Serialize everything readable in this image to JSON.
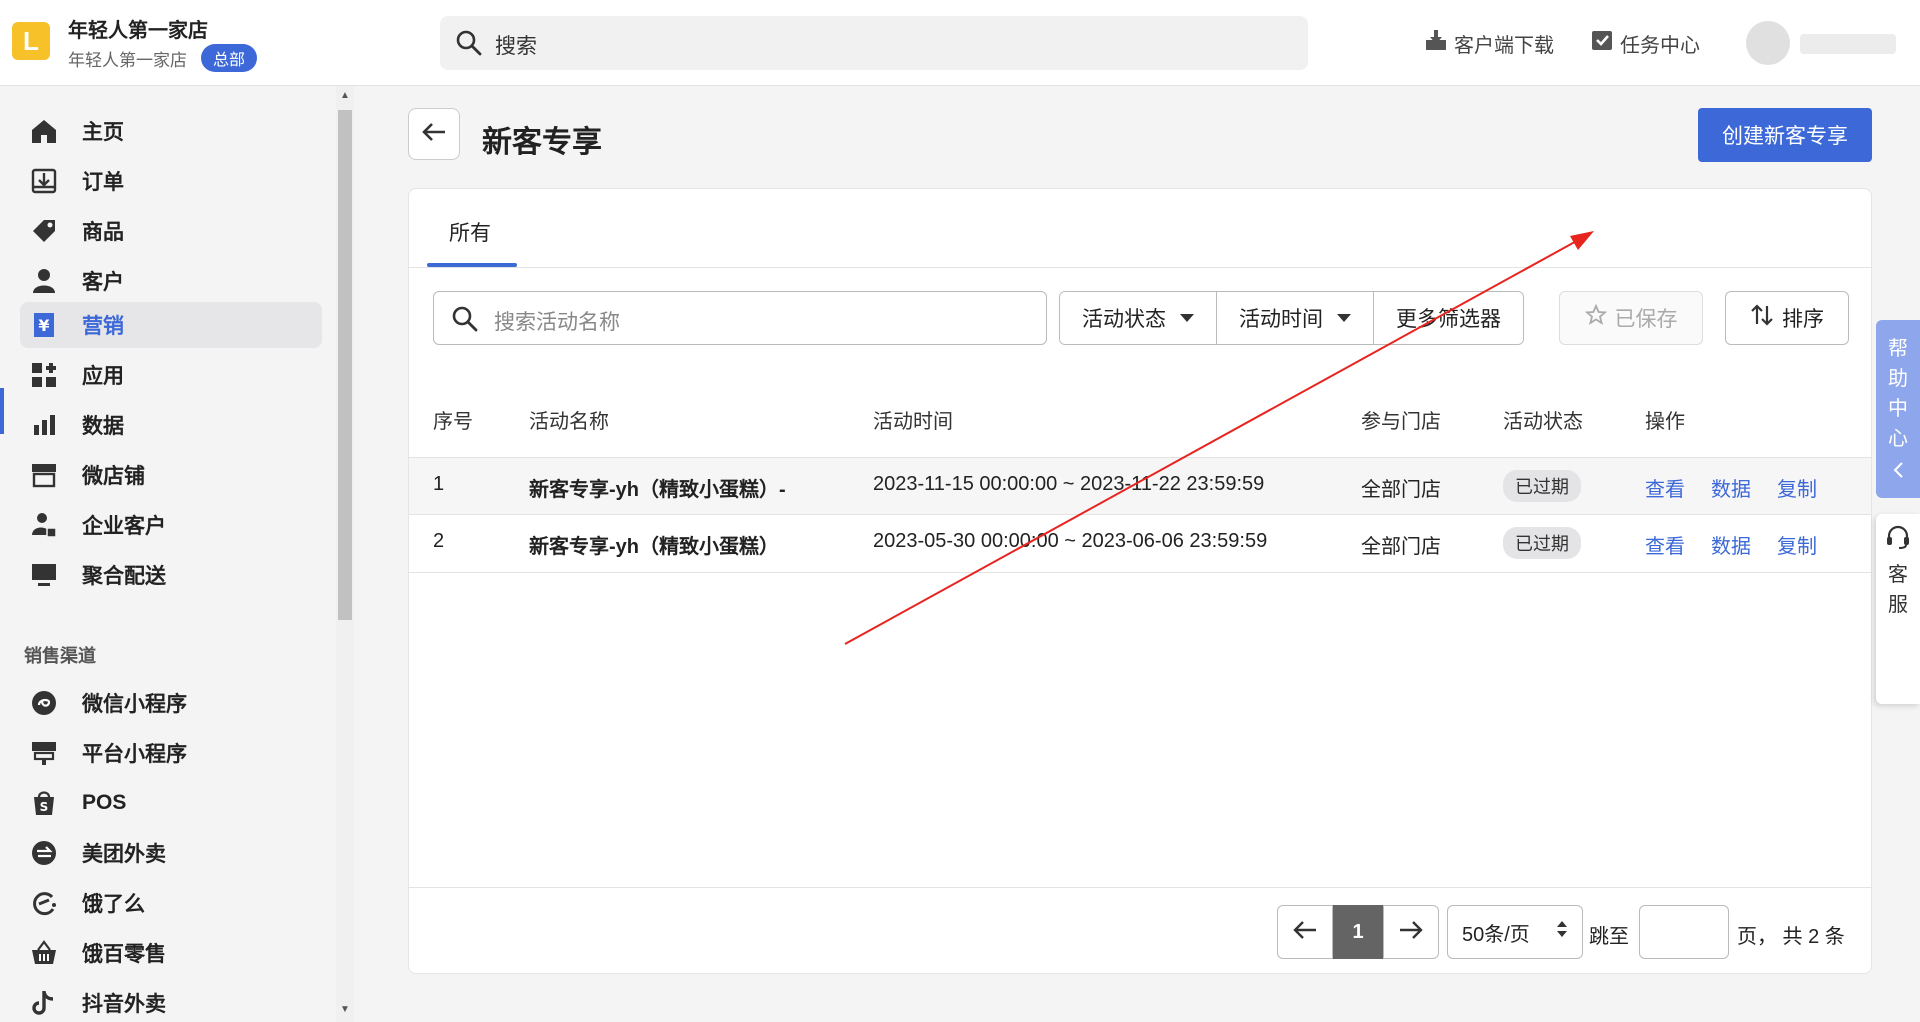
{
  "header": {
    "logo_letter": "L",
    "store_name": "年轻人第一家店",
    "store_sub": "年轻人第一家店",
    "hq_badge": "总部",
    "search_placeholder": "搜索",
    "download_label": "客户端下载",
    "tasks_label": "任务中心"
  },
  "sidebar": {
    "items": [
      {
        "label": "主页",
        "icon": "home-icon"
      },
      {
        "label": "订单",
        "icon": "order-icon"
      },
      {
        "label": "商品",
        "icon": "tag-icon"
      },
      {
        "label": "客户",
        "icon": "person-icon"
      },
      {
        "label": "营销",
        "icon": "yen-ticket-icon"
      },
      {
        "label": "应用",
        "icon": "apps-icon"
      },
      {
        "label": "数据",
        "icon": "bar-chart-icon"
      },
      {
        "label": "微店铺",
        "icon": "store-icon"
      },
      {
        "label": "企业客户",
        "icon": "enterprise-icon"
      },
      {
        "label": "聚合配送",
        "icon": "monitor-icon"
      }
    ],
    "section_title": "销售渠道",
    "channels": [
      {
        "label": "微信小程序",
        "icon": "mini-program-icon"
      },
      {
        "label": "平台小程序",
        "icon": "platform-icon"
      },
      {
        "label": "POS",
        "icon": "shopping-bag-icon"
      },
      {
        "label": "美团外卖",
        "icon": "meituan-icon"
      },
      {
        "label": "饿了么",
        "icon": "eleme-icon"
      },
      {
        "label": "饿百零售",
        "icon": "basket-icon"
      },
      {
        "label": "抖音外卖",
        "icon": "douyin-icon"
      }
    ]
  },
  "page": {
    "title": "新客专享",
    "create_button": "创建新客专享",
    "tab_all": "所有"
  },
  "filters": {
    "search_placeholder": "搜索活动名称",
    "status": "活动状态",
    "time": "活动时间",
    "more": "更多筛选器",
    "saved": "已保存",
    "sort": "排序"
  },
  "table": {
    "columns": [
      "序号",
      "活动名称",
      "活动时间",
      "参与门店",
      "活动状态",
      "操作"
    ],
    "rows": [
      {
        "index": "1",
        "name": "新客专享-yh（精致小蛋糕）-",
        "time": "2023-11-15 00:00:00 ~ 2023-11-22 23:59:59",
        "stores": "全部门店",
        "status": "已过期",
        "view": "查看",
        "data": "数据",
        "copy": "复制"
      },
      {
        "index": "2",
        "name": "新客专享-yh（精致小蛋糕）",
        "time": "2023-05-30 00:00:00 ~ 2023-06-06 23:59:59",
        "stores": "全部门店",
        "status": "已过期",
        "view": "查看",
        "data": "数据",
        "copy": "复制"
      }
    ]
  },
  "pagination": {
    "current_page": "1",
    "page_size": "50条/页",
    "jump_label": "跳至",
    "total_text": "页，  共 2 条"
  },
  "floating": {
    "help_chars": [
      "帮",
      "助",
      "中",
      "心"
    ],
    "service_chars": [
      "客",
      "服"
    ]
  },
  "colors": {
    "accent": "#3c68d8",
    "annotation_arrow": "#e8241f",
    "logo": "#f7c12a"
  }
}
